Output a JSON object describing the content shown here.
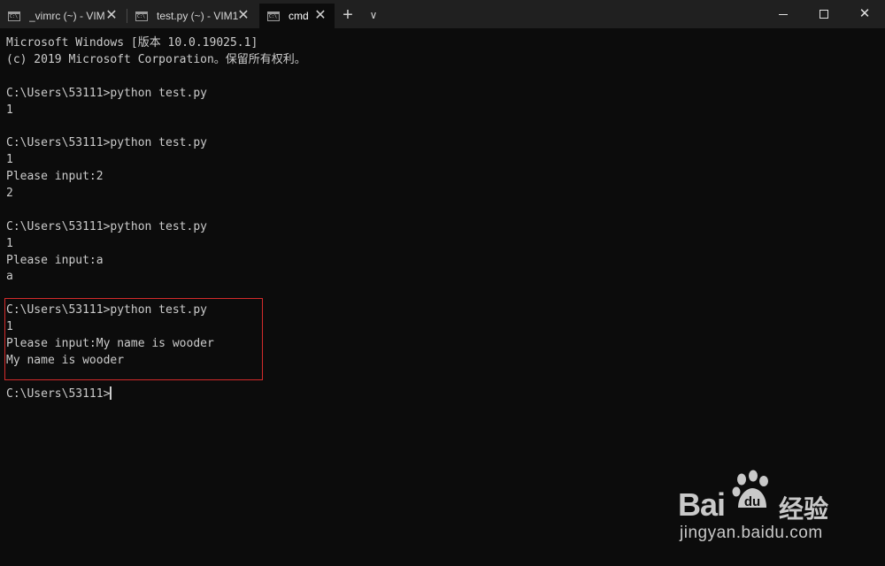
{
  "tabs": [
    {
      "label": "_vimrc (~) - VIM",
      "icon": "console-icon",
      "active": false
    },
    {
      "label": "test.py (~) - VIM1",
      "icon": "console-icon",
      "active": false
    },
    {
      "label": "cmd",
      "icon": "console-icon",
      "active": true
    }
  ],
  "tabbar": {
    "new_tab_glyph": "+",
    "dropdown_glyph": "∨",
    "close_glyph": "✕"
  },
  "terminal": {
    "lines": [
      "Microsoft Windows [版本 10.0.19025.1]",
      "(c) 2019 Microsoft Corporation。保留所有权利。",
      "",
      "C:\\Users\\53111>python test.py",
      "1",
      "",
      "C:\\Users\\53111>python test.py",
      "1",
      "Please input:2",
      "2",
      "",
      "C:\\Users\\53111>python test.py",
      "1",
      "Please input:a",
      "a",
      "",
      "C:\\Users\\53111>python test.py",
      "1",
      "Please input:My name is wooder",
      "My name is wooder",
      "",
      "C:\\Users\\53111>"
    ]
  },
  "watermark": {
    "logo_text": "Bai",
    "logo_text_2": "du",
    "brand_cn": "经验",
    "url": "jingyan.baidu.com"
  },
  "colors": {
    "background": "#0c0c0c",
    "tabbar": "#202020",
    "text": "#cccccc",
    "highlight_border": "#d42b2b"
  }
}
